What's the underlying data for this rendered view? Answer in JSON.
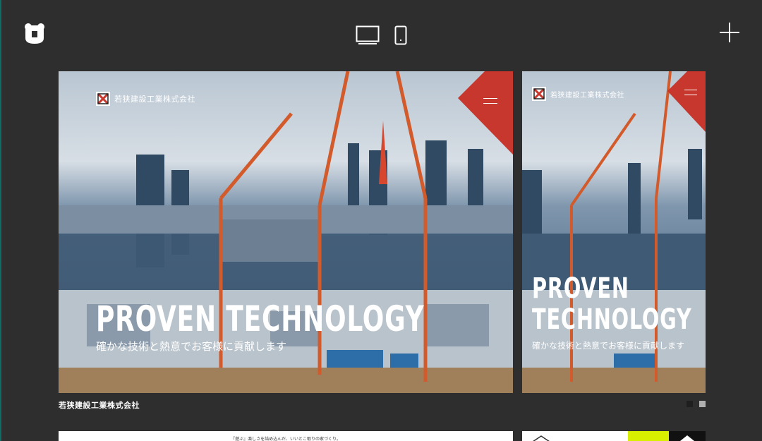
{
  "toolbar": {
    "logo_icon": "bear-icon",
    "desktop_icon": "monitor-icon",
    "mobile_icon": "smartphone-icon",
    "add_icon": "plus-icon"
  },
  "preview": {
    "company_logo_text": "若狭建設工業株式会社",
    "headline_line1": "PROVEN",
    "headline_line2": "TECHNOLOGY",
    "headline_full": "PROVEN TECHNOLOGY",
    "subheadline": "確かな技術と熱意でお客様に貢献します",
    "menu_icon": "hamburger-icon",
    "accent_color": "#c8372d"
  },
  "gallery": {
    "caption": "若狭建設工業株式会社",
    "pagination": {
      "total": 2,
      "active": 2
    }
  },
  "next_card": {
    "tagline": "『遊ぶ』楽しさを詰め込んだ、いいとこ取りの家づくり。"
  }
}
